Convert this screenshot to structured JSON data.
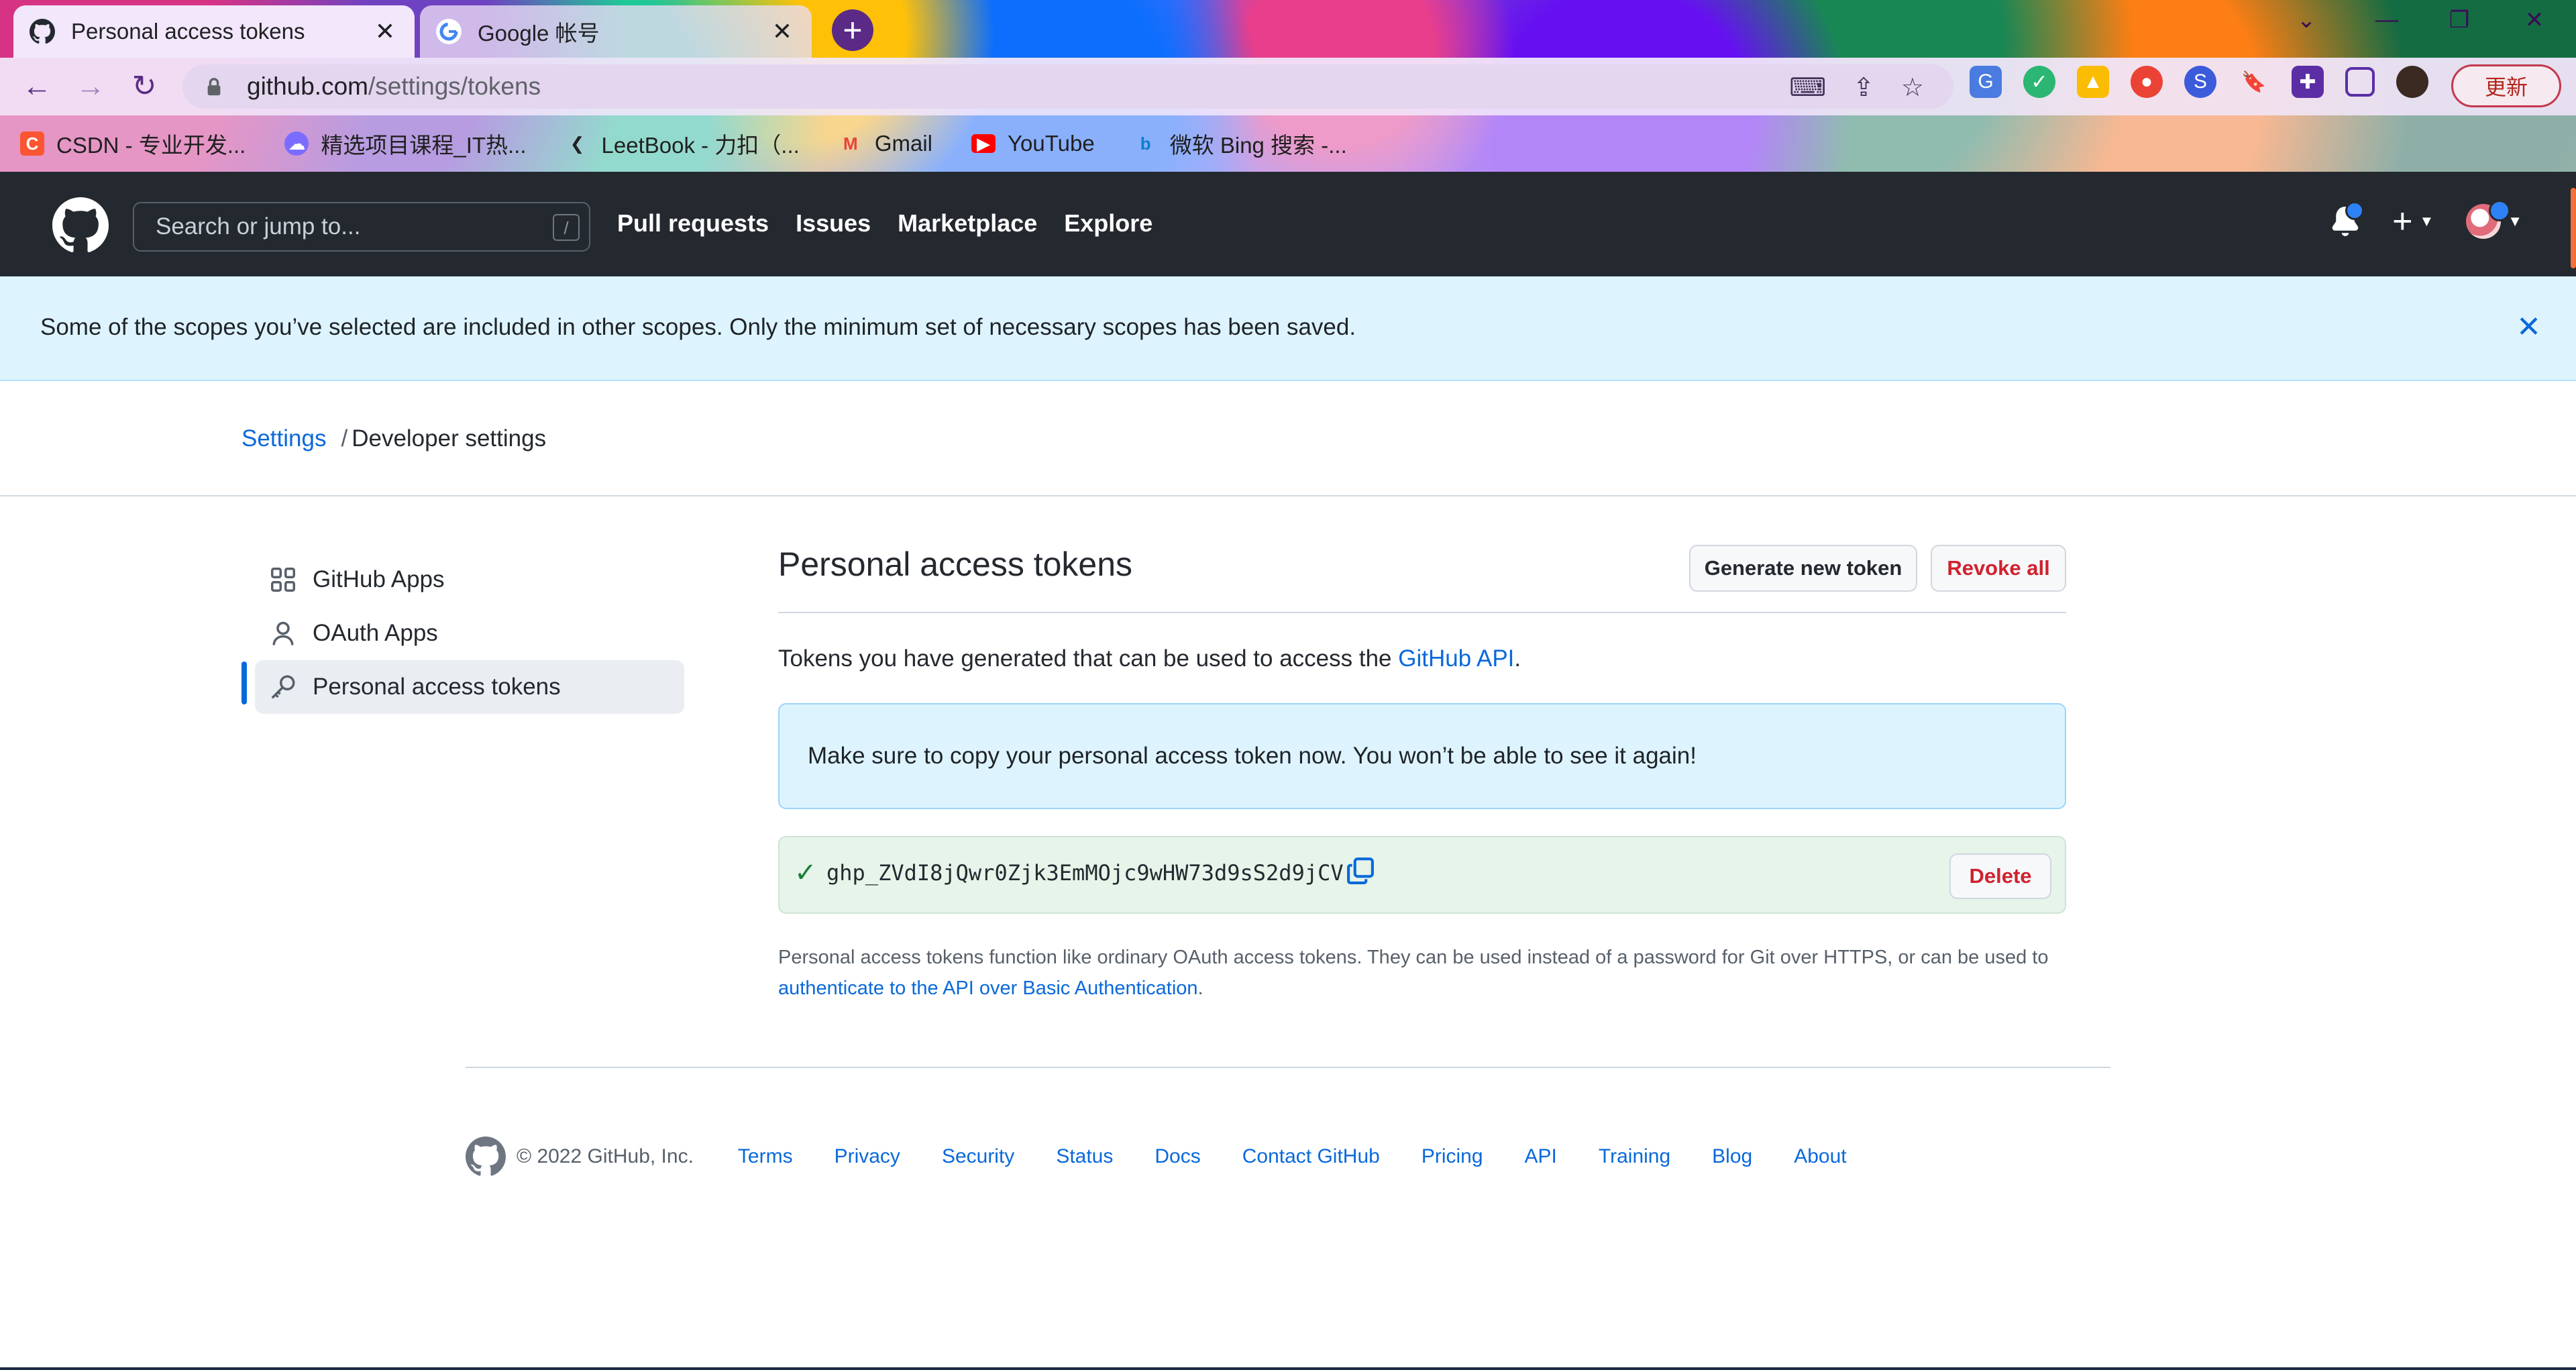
{
  "browser": {
    "tabs": [
      {
        "title": "Personal access tokens",
        "active": true,
        "favicon": "github-icon"
      },
      {
        "title": "Google 帐号",
        "active": false,
        "favicon": "google-icon"
      }
    ],
    "url_host": "github.com",
    "url_path": "/settings/tokens",
    "update_label": "更新",
    "bookmarks": [
      {
        "label": "CSDN - 专业开发...",
        "icon": "csdn-icon",
        "color": "#fc5531"
      },
      {
        "label": "精选项目课程_IT热...",
        "icon": "cloud-icon",
        "color": "#7b6cff"
      },
      {
        "label": "LeetBook - 力扣（...",
        "icon": "leetcode-icon",
        "color": "#222222"
      },
      {
        "label": "Gmail",
        "icon": "gmail-icon",
        "color": "#ea4335"
      },
      {
        "label": "YouTube",
        "icon": "youtube-icon",
        "color": "#ff0000"
      },
      {
        "label": "微软 Bing 搜索 -...",
        "icon": "bing-icon",
        "color": "#0f7ccf"
      }
    ]
  },
  "gh_header": {
    "search_placeholder": "Search or jump to...",
    "search_shortcut": "/",
    "nav": [
      "Pull requests",
      "Issues",
      "Marketplace",
      "Explore"
    ]
  },
  "flash": {
    "message": "Some of the scopes you’ve selected are included in other scopes. Only the minimum set of necessary scopes has been saved."
  },
  "breadcrumb": {
    "settings": "Settings",
    "separator": "/",
    "current": "Developer settings"
  },
  "sidebar": {
    "items": [
      {
        "label": "GitHub Apps",
        "icon": "apps-grid-icon",
        "active": false
      },
      {
        "label": "OAuth Apps",
        "icon": "person-icon",
        "active": false
      },
      {
        "label": "Personal access tokens",
        "icon": "key-icon",
        "active": true
      }
    ]
  },
  "main": {
    "title": "Personal access tokens",
    "generate_label": "Generate new token",
    "revoke_label": "Revoke all",
    "description_prefix": "Tokens you have generated that can be used to access the ",
    "description_link": "GitHub API",
    "description_suffix": ".",
    "notice": "Make sure to copy your personal access token now. You won’t be able to see it again!",
    "token": "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",
    "delete_label": "Delete",
    "footnote_text": "Personal access tokens function like ordinary OAuth access tokens. They can be used instead of a password for Git over HTTPS, or can be used to ",
    "footnote_link": "authenticate to the API over Basic Authentication",
    "footnote_end": "."
  },
  "footer": {
    "copyright": "© 2022 GitHub, Inc.",
    "links": [
      "Terms",
      "Privacy",
      "Security",
      "Status",
      "Docs",
      "Contact GitHub",
      "Pricing",
      "API",
      "Training",
      "Blog",
      "About"
    ]
  },
  "colors": {
    "header_bg": "#24292f",
    "link": "#0969da",
    "danger": "#cf222e",
    "flash_bg": "#ddf4ff",
    "token_bg": "#e6f4ea"
  }
}
